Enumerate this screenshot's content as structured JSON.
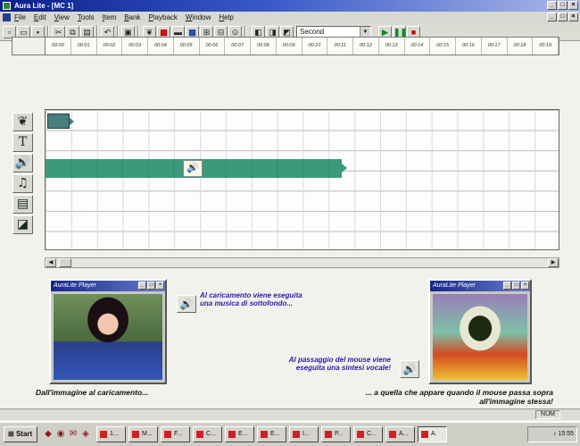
{
  "window": {
    "title": "Aura Lite - [MC 1]"
  },
  "menu": [
    "File",
    "Edit",
    "View",
    "Tools",
    "Item",
    "Bank",
    "Playback",
    "Window",
    "Help"
  ],
  "toolbar": {
    "time_unit": "Second",
    "buttons": [
      "new-icon",
      "open-icon",
      "save-icon",
      "cut-icon",
      "copy-icon",
      "paste-icon",
      "undo-icon",
      "properties-icon",
      "image-tool-icon",
      "text-tool-icon",
      "track-icon",
      "grid-icon",
      "frame-icon",
      "zoom-icon",
      "options-icon"
    ],
    "playback": [
      "play-icon",
      "pause-icon",
      "stop-icon"
    ]
  },
  "ruler": [
    "00:00",
    "00:01",
    "00:02",
    "00:03",
    "00:04",
    "00:05",
    "00:06",
    "00:07",
    "00:08",
    "00:09",
    "00:10",
    "00:11",
    "00:12",
    "00:13",
    "00:14",
    "00:15",
    "00:16",
    "00:17",
    "00:18",
    "00:19"
  ],
  "tracks": [
    "image-track-icon",
    "text-track-icon",
    "audio-track-icon",
    "music-track-icon",
    "document-track-icon",
    "frame-track-icon"
  ],
  "player_left": {
    "title": "AuraLite Player"
  },
  "player_right": {
    "title": "AuraLite Player"
  },
  "captions": {
    "load_note": "Al caricamento viene eseguita una musica di sottofondo...",
    "hover_note": "Al passaggio del mouse viene eseguita una sintesi vocale!",
    "from_image": "Dall'immagine al caricamento...",
    "to_image": "... a quella che appare quando il mouse passa sopra all'immagine stessa!"
  },
  "status": {
    "num": "NUM"
  },
  "taskbar": {
    "start": "Start",
    "tasks": [
      "1...",
      "M...",
      "F...",
      "C...",
      "E...",
      "E...",
      "I...",
      "P...",
      "C...",
      "A...",
      "A."
    ],
    "clock": "15:55"
  },
  "colors": {
    "title_bar": "#0a1f8a",
    "audio_clip": "#3a9a7a",
    "caption_blue": "#2a1aa8"
  }
}
